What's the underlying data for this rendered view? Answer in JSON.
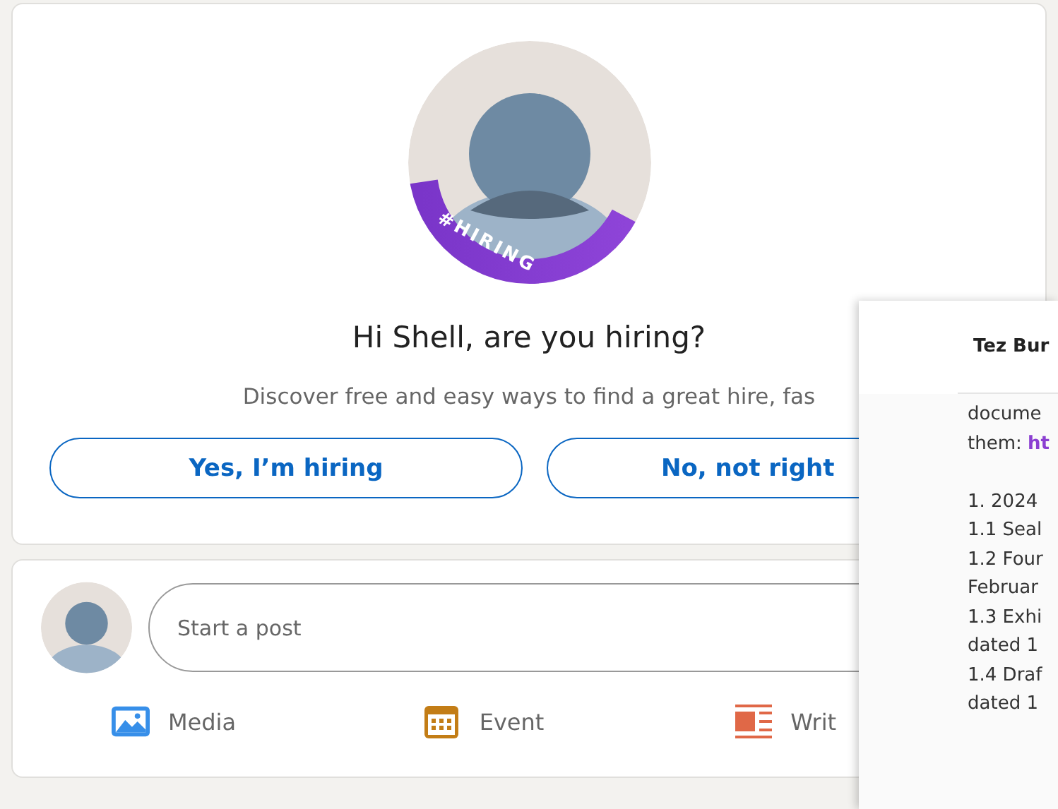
{
  "hiring_card": {
    "badge": "#HIRING",
    "title": "Hi Shell, are you hiring?",
    "subtitle": "Discover free and easy ways to find a great hire, fas",
    "buttons": [
      "Yes, I’m hiring",
      "No, not right"
    ]
  },
  "post_card": {
    "placeholder": "Start a post",
    "actions": [
      {
        "kind": "media",
        "label": "Media"
      },
      {
        "kind": "event",
        "label": "Event"
      },
      {
        "kind": "write",
        "label": "Writ"
      }
    ]
  },
  "popup": {
    "title": "Tez Bur",
    "lines": [
      {
        "text": "docume"
      },
      {
        "text": "them: **ht**"
      },
      {
        "text": "1. 2024",
        "gap_before": true
      },
      {
        "text": "1.1 Seal"
      },
      {
        "text": "1.2 Four"
      },
      {
        "text": "Februar"
      },
      {
        "text": "1.3 Exhi"
      },
      {
        "text": "dated 1"
      },
      {
        "text": "1.4 Draf"
      },
      {
        "text": "dated 1"
      }
    ]
  }
}
